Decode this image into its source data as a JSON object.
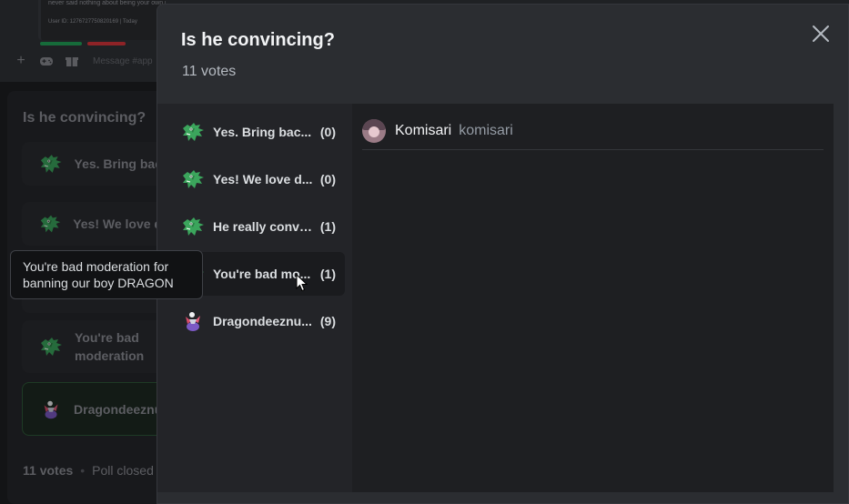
{
  "background": {
    "message_line": "never said nothing about being your own person :/",
    "message_meta": "User ID: 1276727750820169 | Today",
    "input_placeholder": "Message #app",
    "poll_question": "Is he convincing?",
    "poll_options": [
      "Yes. Bring back",
      "Yes! We love dra",
      "",
      "You're bad moderation for banning our boy DRAGON",
      "Dragondeeznuts"
    ],
    "footer_votes": "11 votes",
    "footer_dot": "•",
    "footer_status": "Poll closed"
  },
  "tooltip": {
    "text": "You're bad moderation for banning our boy DRAGON"
  },
  "modal": {
    "title": "Is he convincing?",
    "votes_label": "11 votes",
    "close_icon": "close-icon"
  },
  "answers": [
    {
      "label": "Yes. Bring bac...",
      "count": "(0)",
      "emoji": "dragon-icon",
      "active": false
    },
    {
      "label": "Yes! We love d...",
      "count": "(0)",
      "emoji": "dragon-icon",
      "active": false
    },
    {
      "label": "He really convi...",
      "count": "(1)",
      "emoji": "dragon-icon",
      "active": false
    },
    {
      "label": "You're bad mo...",
      "count": "(1)",
      "emoji": "dragon-icon",
      "active": true
    },
    {
      "label": "Dragondeeznu...",
      "count": "(9)",
      "emoji": "custom-emoji-icon",
      "active": false
    }
  ],
  "voters": [
    {
      "display_name": "Komisari",
      "username": "komisari"
    }
  ],
  "colors": {
    "accent_green": "#23a55a",
    "danger_red": "#da373c",
    "dragon_green": "#3ba55c"
  }
}
